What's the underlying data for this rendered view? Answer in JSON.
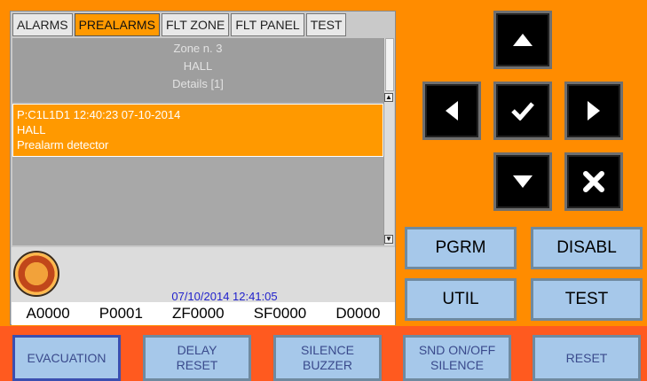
{
  "tabs": [
    "ALARMS",
    "PREALARMS",
    "FLT ZONE",
    "FLT PANEL",
    "TEST"
  ],
  "active_tab": "PREALARMS",
  "zone": {
    "name": "Zone n. 3",
    "location": "HALL",
    "details": "Details [1]"
  },
  "event": {
    "line1": "P:C1L1D1 12:40:23 07-10-2014",
    "line2": "HALL",
    "line3": "Prealarm detector"
  },
  "status": {
    "datetime": "07/10/2014 12:41:05",
    "counters": [
      "A0000",
      "P0001",
      "ZF0000",
      "SF0000",
      "D0000"
    ]
  },
  "nav_buttons": {
    "up": "arrow-up-icon",
    "left": "arrow-left-icon",
    "ok": "checkmark-icon",
    "right": "arrow-right-icon",
    "down": "arrow-down-icon",
    "cancel": "cross-icon"
  },
  "function_buttons": {
    "pgrm": "PGRM",
    "disabl": "DISABL",
    "util": "UTIL",
    "test": "TEST"
  },
  "bottom_buttons": {
    "evacuation": "EVACUATION",
    "delay_reset": "DELAY\nRESET",
    "silence_buzzer": "SILENCE\nBUZZER",
    "snd_silence": "SND ON/OFF\nSILENCE",
    "reset": "RESET"
  },
  "colors": {
    "background": "#FF8C00",
    "active_tab": "#FF9900",
    "button": "#A6C8EA",
    "bottom_bar": "#FF5A1F",
    "datetime_text": "#2222CC"
  }
}
